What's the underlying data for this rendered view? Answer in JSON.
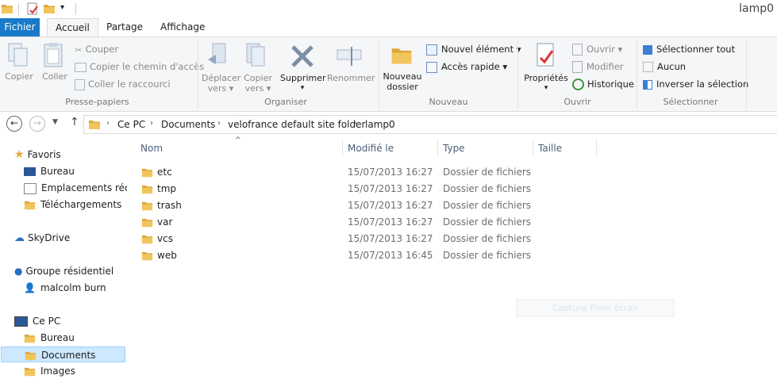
{
  "window": {
    "title": "lamp0"
  },
  "tabs": [
    {
      "label": "Fichier"
    },
    {
      "label": "Accueil"
    },
    {
      "label": "Partage"
    },
    {
      "label": "Affichage"
    }
  ],
  "ribbon": {
    "clipboard": {
      "label": "Presse-papiers",
      "copy": "Copier",
      "paste": "Coller",
      "cut": "Couper",
      "copy_path": "Copier le chemin d'accès",
      "paste_shortcut": "Coller le raccourci"
    },
    "organize": {
      "label": "Organiser",
      "move_to_1": "Déplacer",
      "move_to_2": "vers",
      "copy_to_1": "Copier",
      "copy_to_2": "vers",
      "delete": "Supprimer",
      "rename": "Renommer"
    },
    "new": {
      "label": "Nouveau",
      "new_folder_1": "Nouveau",
      "new_folder_2": "dossier",
      "new_item": "Nouvel élément",
      "easy_access": "Accès rapide"
    },
    "open": {
      "label": "Ouvrir",
      "properties": "Propriétés",
      "open": "Ouvrir",
      "edit": "Modifier",
      "history": "Historique"
    },
    "select": {
      "label": "Sélectionner",
      "select_all": "Sélectionner tout",
      "select_none": "Aucun",
      "invert": "Inverser la sélection"
    }
  },
  "address": {
    "crumbs": [
      "Ce PC",
      "Documents",
      "velofrance default site folder",
      "lamp0"
    ]
  },
  "nav": {
    "favorites": "Favoris",
    "fav_items": [
      "Bureau",
      "Emplacements récents",
      "Téléchargements"
    ],
    "skydrive": "SkyDrive",
    "homegroup": "Groupe résidentiel",
    "homegroup_user": "malcolm burn",
    "thispc": "Ce PC",
    "pc_items": [
      "Bureau",
      "Documents",
      "Images"
    ]
  },
  "list": {
    "columns": {
      "name": "Nom",
      "modified": "Modifié le",
      "type": "Type",
      "size": "Taille"
    },
    "rows": [
      {
        "name": "etc",
        "modified": "15/07/2013 16:27",
        "type": "Dossier de fichiers"
      },
      {
        "name": "tmp",
        "modified": "15/07/2013 16:27",
        "type": "Dossier de fichiers"
      },
      {
        "name": "trash",
        "modified": "15/07/2013 16:27",
        "type": "Dossier de fichiers"
      },
      {
        "name": "var",
        "modified": "15/07/2013 16:27",
        "type": "Dossier de fichiers"
      },
      {
        "name": "vcs",
        "modified": "15/07/2013 16:27",
        "type": "Dossier de fichiers"
      },
      {
        "name": "web",
        "modified": "15/07/2013 16:45",
        "type": "Dossier de fichiers"
      }
    ]
  },
  "overlay": {
    "text": "Capture Plein écran"
  },
  "colors": {
    "accent": "#1979ca",
    "folder": "#e8b43a",
    "selection": "#cde8ff"
  }
}
